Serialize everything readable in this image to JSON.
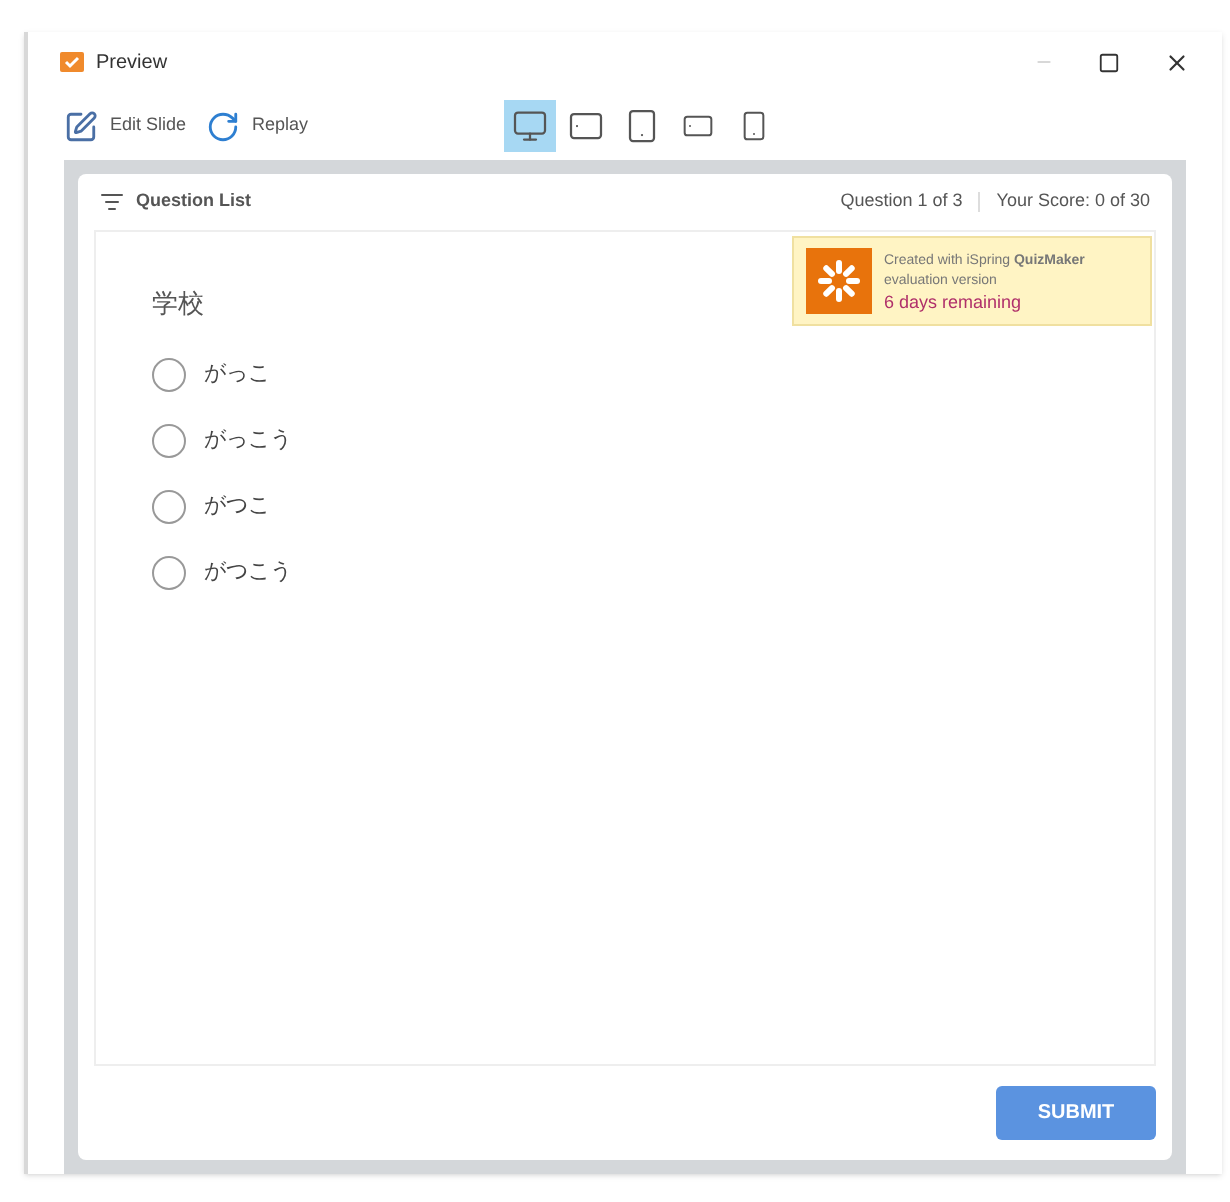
{
  "window": {
    "title": "Preview"
  },
  "toolbar": {
    "buttons": [
      {
        "kind": "edit",
        "label": "Edit Slide"
      },
      {
        "kind": "replay",
        "label": "Replay"
      }
    ],
    "devices": [
      {
        "kind": "desktop",
        "selected": true
      },
      {
        "kind": "tablet-landscape",
        "selected": false
      },
      {
        "kind": "tablet-portrait",
        "selected": false
      },
      {
        "kind": "phone-landscape",
        "selected": false
      },
      {
        "kind": "phone-portrait",
        "selected": false
      }
    ]
  },
  "header": {
    "question_list": "Question List",
    "progress": "Question 1 of 3",
    "score": "Your Score: 0 of 30"
  },
  "notice": {
    "text": "Created with iSpring **QuizMaker**",
    "subtext": "evaluation version",
    "remaining": "6 days remaining"
  },
  "question": {
    "text": "学校",
    "options": [
      {
        "label": "がっこ",
        "selected": false
      },
      {
        "label": "がっこう",
        "selected": false
      },
      {
        "label": "がつこ",
        "selected": false
      },
      {
        "label": "がつこう",
        "selected": false
      }
    ]
  },
  "submit": "SUBMIT"
}
